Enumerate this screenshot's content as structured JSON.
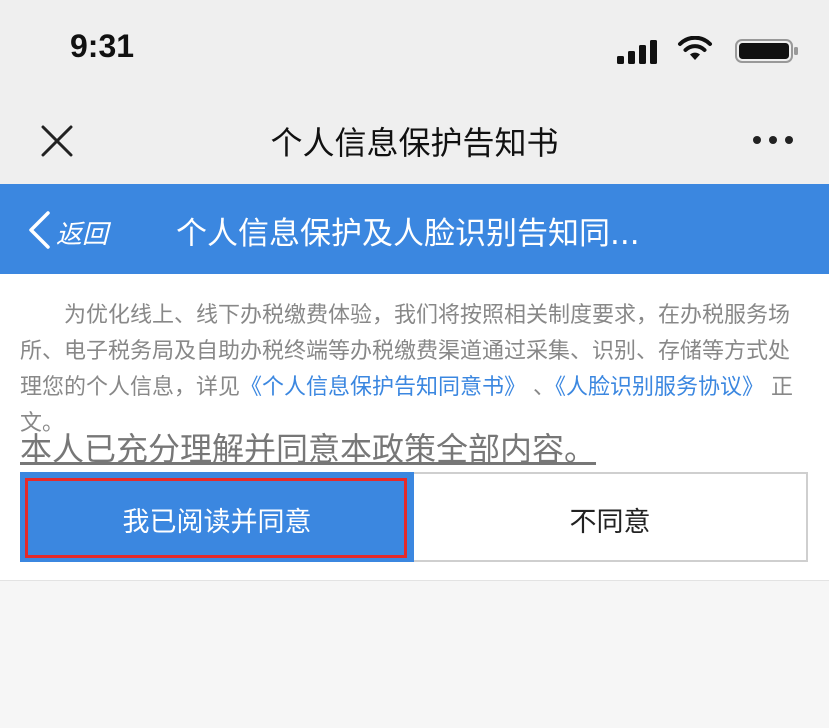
{
  "status_bar": {
    "time": "9:31",
    "icons": [
      "signal-icon",
      "wifi-icon",
      "battery-icon"
    ]
  },
  "title_bar": {
    "title": "个人信息保护告知书",
    "left_icon": "close-icon",
    "right_icon": "more-icon"
  },
  "nav_bar": {
    "back_label": "返回",
    "back_icon": "chevron-left-icon",
    "title": "个人信息保护及人脸识别告知同..."
  },
  "notice": {
    "text_before": "为优化线上、线下办税缴费体验，我们将按照相关制度要求，在办税服务场所、电子税务局及自助办税终端等办税缴费渠道通过采集、识别、存储等方式处理您的个人信息，详见",
    "link_1": "《个人信息保护告知同意书》",
    "separator": " 、",
    "link_2": "《人脸识别服务协议》",
    "text_after": " 正文。"
  },
  "consent_text": "本人已充分理解并同意本政策全部内容。",
  "buttons": {
    "agree_label": "我已阅读并同意",
    "disagree_label": "不同意"
  },
  "colors": {
    "accent": "#3b87e0",
    "highlight": "#e52a2a",
    "body_text": "#888888"
  }
}
